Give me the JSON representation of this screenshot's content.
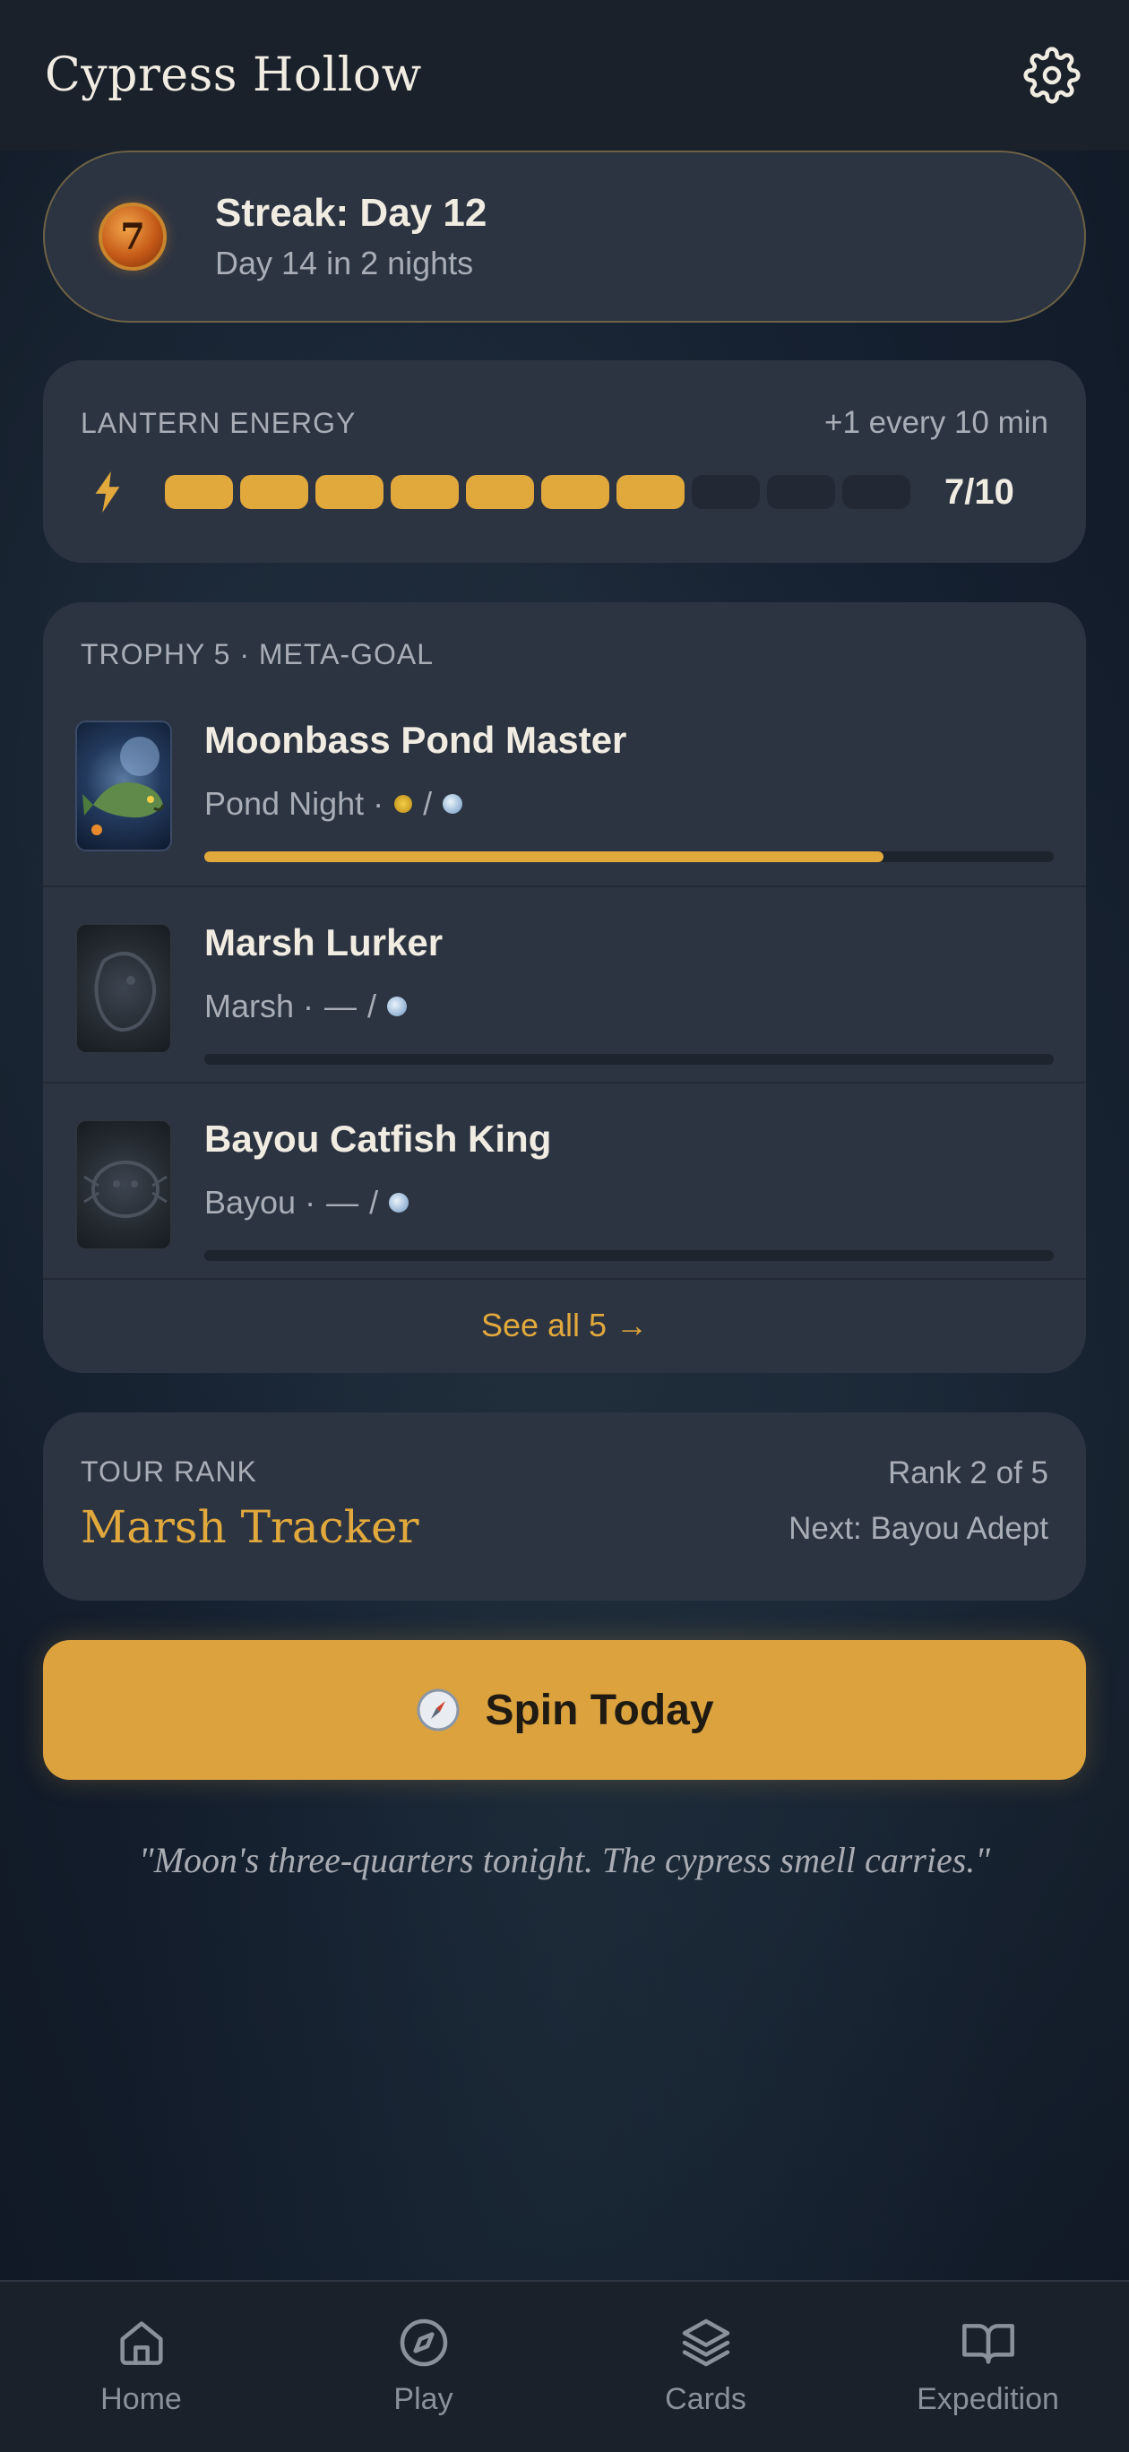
{
  "header": {
    "title": "Cypress Hollow",
    "settings_icon": "gear-icon"
  },
  "streak": {
    "badge": "7",
    "title": "Streak: Day 12",
    "subtitle": "Day 14 in 2 nights"
  },
  "energy": {
    "label": "LANTERN ENERGY",
    "rate": "+1 every 10 min",
    "current": 7,
    "max": 10,
    "count_text": "7/10",
    "icon": "lightning-bolt-icon",
    "accent": "#e1a83c"
  },
  "trophy": {
    "header": "TROPHY 5 · META-GOAL",
    "items": [
      {
        "title": "Moonbass Pond Master",
        "location": "Pond Night ·",
        "first_slot": "sun-dot",
        "separator": "/",
        "progress": 0.8
      },
      {
        "title": "Marsh Lurker",
        "location": "Marsh ·",
        "first_slot": "—",
        "separator": "/",
        "progress": 0
      },
      {
        "title": "Bayou Catfish King",
        "location": "Bayou ·",
        "first_slot": "—",
        "separator": "/",
        "progress": 0
      }
    ],
    "see_all": "See all 5 →"
  },
  "rank": {
    "label": "TOUR RANK",
    "name": "Marsh Tracker",
    "position": "Rank 2 of 5",
    "next": "Next: Bayou Adept"
  },
  "spin": {
    "label": "Spin Today",
    "icon": "compass-icon"
  },
  "quote": "\"Moon's three-quarters tonight. The cypress smell carries.\"",
  "nav": {
    "items": [
      {
        "label": "Home",
        "icon": "home-icon"
      },
      {
        "label": "Play",
        "icon": "compass-icon"
      },
      {
        "label": "Cards",
        "icon": "layers-icon"
      },
      {
        "label": "Expedition",
        "icon": "book-icon"
      }
    ]
  },
  "colors": {
    "background": "#152030",
    "card": "#2c3442",
    "accent": "#e1a83c",
    "text_muted": "#a8adb6"
  }
}
